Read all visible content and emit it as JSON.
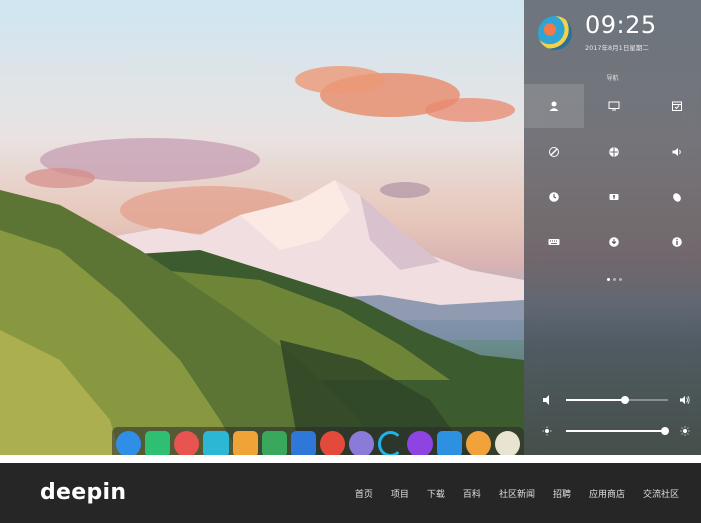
{
  "control_center": {
    "time": "09:25",
    "date": "2017年8月1日星期二",
    "nav_label": "导航",
    "tiles": [
      {
        "icon": "user-icon"
      },
      {
        "icon": "display-icon"
      },
      {
        "icon": "calendar-icon"
      },
      {
        "icon": "theme-icon"
      },
      {
        "icon": "network-icon"
      },
      {
        "icon": "sound-icon"
      },
      {
        "icon": "clock-icon"
      },
      {
        "icon": "power-icon"
      },
      {
        "icon": "mouse-icon"
      },
      {
        "icon": "keyboard-icon"
      },
      {
        "icon": "update-icon"
      },
      {
        "icon": "info-icon"
      }
    ],
    "volume_level": 0.58,
    "brightness_level": 0.97
  },
  "dock": {
    "apps": [
      {
        "name": "launcher-icon",
        "color": "#2f8ee6"
      },
      {
        "name": "terminal-icon",
        "color": "#2fbf72"
      },
      {
        "name": "screen-recorder-icon",
        "color": "#e8544f"
      },
      {
        "name": "app-store-icon",
        "color": "#2cb7d4"
      },
      {
        "name": "files-icon",
        "color": "#f0a438"
      },
      {
        "name": "music-icon",
        "color": "#3aa85c"
      },
      {
        "name": "video-icon",
        "color": "#2f77d9"
      },
      {
        "name": "chrome-icon",
        "color": "#e44a3c"
      },
      {
        "name": "settings-icon",
        "color": "#8b7bd8"
      },
      {
        "name": "loading-icon",
        "color": "#1fb3e8"
      },
      {
        "name": "shutdown-icon",
        "color": "#8e44e0"
      },
      {
        "name": "screenshot-icon",
        "color": "#2c91e0"
      },
      {
        "name": "browser-icon",
        "color": "#f2a23b"
      },
      {
        "name": "extra-icon",
        "color": "#e9e3d2"
      }
    ]
  },
  "header": {
    "logo": "deepin",
    "nav": [
      "首页",
      "项目",
      "下载",
      "百科",
      "社区新闻",
      "招聘",
      "应用商店",
      "交流社区"
    ]
  }
}
